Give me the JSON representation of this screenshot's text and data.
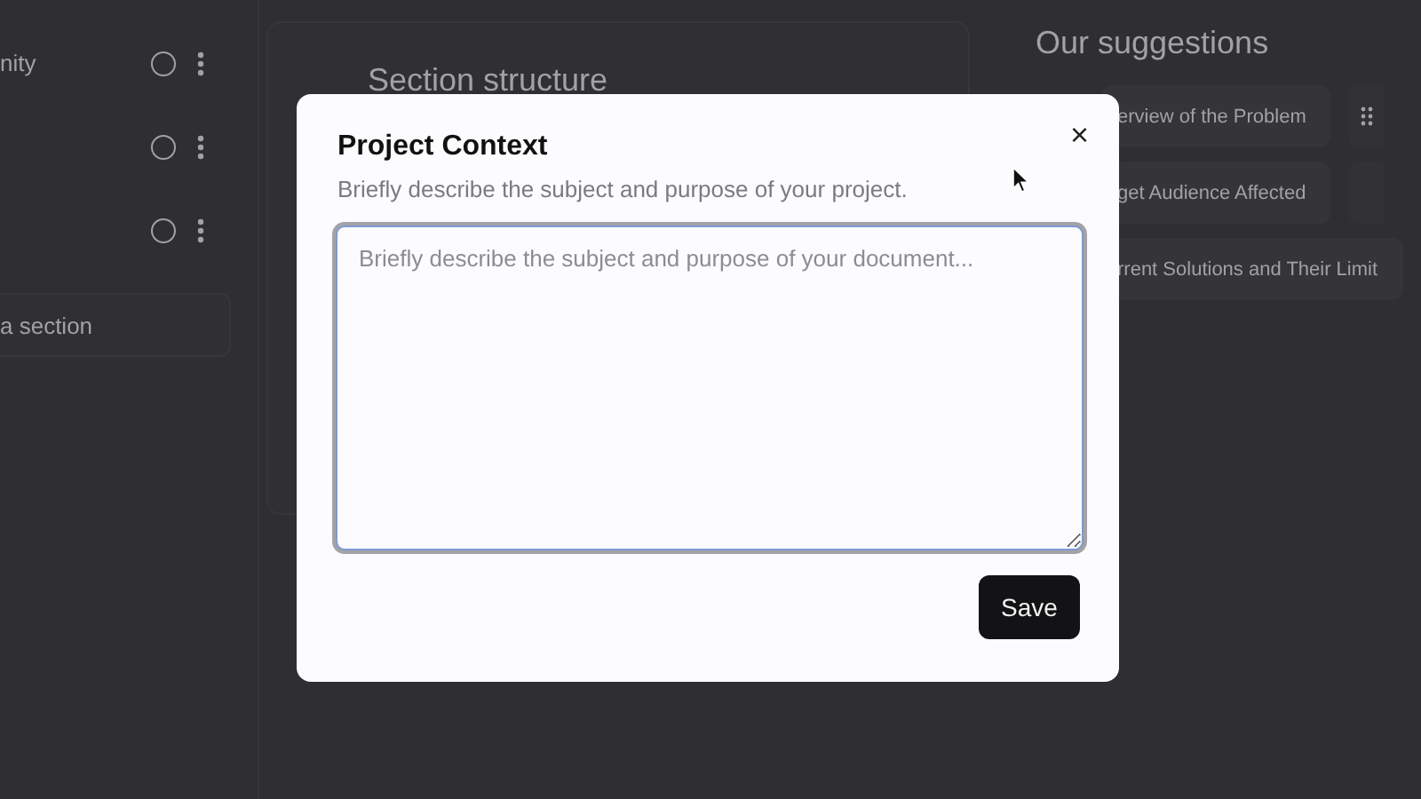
{
  "sections_list": {
    "rows": [
      {
        "label": "nity"
      },
      {},
      {}
    ],
    "add_button": "a section"
  },
  "structure_panel": {
    "title": "Section structure"
  },
  "suggestions": {
    "title": "Our suggestions",
    "chips": [
      {
        "label": "erview of the Problem"
      },
      {
        "label": "get Audience Affected"
      },
      {
        "label": "rrent Solutions and Their Limit"
      }
    ]
  },
  "dialog": {
    "title": "Project Context",
    "subtitle": "Briefly describe the subject and purpose of your project.",
    "textarea": {
      "placeholder": "Briefly describe the subject and purpose of your document..."
    },
    "close": "×",
    "save_button": "Save"
  }
}
